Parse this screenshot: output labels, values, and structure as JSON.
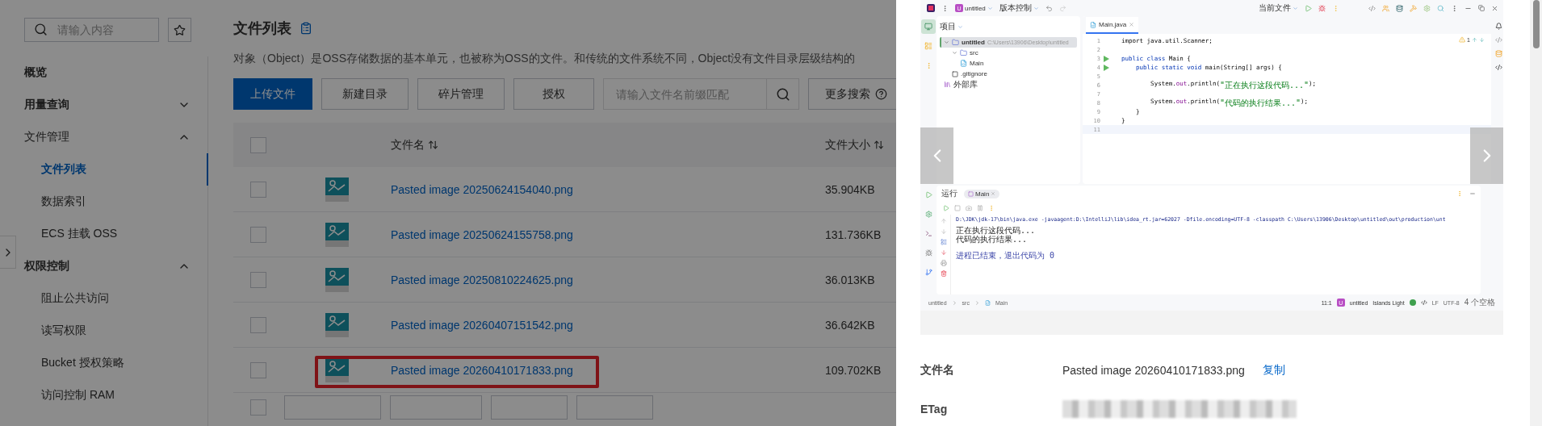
{
  "sidebar": {
    "search": {
      "placeholder": "请输入内容"
    },
    "items": [
      {
        "kind": "link",
        "label": "概览"
      },
      {
        "kind": "group",
        "label": "用量查询",
        "expanded": false
      },
      {
        "kind": "group",
        "label": "文件管理",
        "expanded": true,
        "children": [
          {
            "label": "文件列表",
            "selected": true
          },
          {
            "label": "数据索引",
            "selected": false
          },
          {
            "label": "ECS 挂载 OSS",
            "selected": false
          }
        ]
      },
      {
        "kind": "group",
        "label": "权限控制",
        "expanded": true,
        "children": [
          {
            "label": "阻止公共访问",
            "selected": false
          },
          {
            "label": "读写权限",
            "selected": false
          },
          {
            "label": "Bucket 授权策略",
            "selected": false
          },
          {
            "label": "访问控制 RAM",
            "selected": false
          }
        ]
      }
    ]
  },
  "main": {
    "title": "文件列表",
    "description": "对象（Object）是OSS存储数据的基本单元，也被称为OSS的文件。和传统的文件系统不同，Object没有文件目录层级结构的",
    "toolbar": [
      {
        "label": "上传文件",
        "kind": "primary"
      },
      {
        "label": "新建目录",
        "kind": "default"
      },
      {
        "label": "碎片管理",
        "kind": "default"
      },
      {
        "label": "授权",
        "kind": "default"
      }
    ],
    "search": {
      "placeholder": "请输入文件名前缀匹配"
    },
    "more_search": "更多搜索",
    "table": {
      "all_checked": false,
      "partial_row": {
        "checked": false
      },
      "columns": [
        "文件名",
        "文件大小"
      ],
      "rows": [
        {
          "name": "Pasted image 20250624154040.png",
          "size": "35.904KB",
          "checked": false,
          "highlighted": false
        },
        {
          "name": "Pasted image 20250624155758.png",
          "size": "131.736KB",
          "checked": false,
          "highlighted": false
        },
        {
          "name": "Pasted image 20250810224625.png",
          "size": "36.013KB",
          "checked": false,
          "highlighted": false
        },
        {
          "name": "Pasted image 20260407151542.png",
          "size": "36.642KB",
          "checked": false,
          "highlighted": false
        },
        {
          "name": "Pasted image 20260410171833.png",
          "size": "109.702KB",
          "checked": false,
          "highlighted": true
        }
      ]
    }
  },
  "preview": {
    "ide": {
      "project_initial": "U",
      "project": "untitled",
      "vcs": "版本控制",
      "run_config": "当前文件",
      "tree_title": "项目",
      "tree": [
        {
          "label": "untitled",
          "path": "C:\\Users\\13906\\Desktop\\untitled",
          "kind": "folder",
          "selected": true,
          "children": [
            {
              "label": "src",
              "kind": "folder",
              "selected": false,
              "children": [
                {
                  "label": "Main",
                  "kind": "class",
                  "selected": false
                }
              ]
            },
            {
              "label": ".gitignore",
              "kind": "file",
              "selected": false
            }
          ]
        },
        {
          "label": "外部库",
          "kind": "library",
          "selected": false
        }
      ],
      "tab": "Main.java",
      "warnings": "1",
      "code": [
        {
          "number": "1",
          "runnable": false,
          "current": false,
          "tokens": [
            {
              "kind": "plain",
              "text": "import java.util.Scanner;"
            }
          ]
        },
        {
          "number": "2",
          "runnable": false,
          "current": false
        },
        {
          "number": "3",
          "runnable": true,
          "current": false,
          "tokens": [
            {
              "kind": "keyword",
              "text": "public class "
            },
            {
              "kind": "plain",
              "text": "Main {"
            }
          ]
        },
        {
          "number": "4",
          "runnable": true,
          "current": false,
          "tokens": [
            {
              "kind": "keyword",
              "text": "    public static void "
            },
            {
              "kind": "plain",
              "text": "main(String[] args) {"
            }
          ]
        },
        {
          "number": "5",
          "runnable": false,
          "current": false
        },
        {
          "number": "6",
          "runnable": false,
          "current": false,
          "tokens": [
            {
              "kind": "plain",
              "text": "        System."
            },
            {
              "kind": "field",
              "text": "out"
            },
            {
              "kind": "plain",
              "text": ".println("
            },
            {
              "kind": "string",
              "text": "\"正在执行这段代码...\""
            },
            {
              "kind": "plain",
              "text": ");"
            }
          ]
        },
        {
          "number": "7",
          "runnable": false,
          "current": false
        },
        {
          "number": "8",
          "runnable": false,
          "current": false,
          "tokens": [
            {
              "kind": "plain",
              "text": "        System."
            },
            {
              "kind": "field",
              "text": "out"
            },
            {
              "kind": "plain",
              "text": ".println("
            },
            {
              "kind": "string",
              "text": "\"代码的执行结果...\""
            },
            {
              "kind": "plain",
              "text": ");"
            }
          ]
        },
        {
          "number": "9",
          "runnable": false,
          "current": false,
          "tokens": [
            {
              "kind": "plain",
              "text": "    }"
            }
          ]
        },
        {
          "number": "10",
          "runnable": false,
          "current": false,
          "tokens": [
            {
              "kind": "plain",
              "text": "}"
            }
          ]
        },
        {
          "number": "11",
          "runnable": false,
          "current": true
        }
      ],
      "run_title": "运行",
      "run_tab": "Main",
      "console": [
        {
          "kind": "command",
          "text": "D:\\JDK\\jdk-17\\bin\\java.exe -javaagent:D:\\IntelliJ\\lib\\idea_rt.jar=62027 -Dfile.encoding=UTF-8 -classpath C:\\Users\\13906\\Desktop\\untitled\\out\\production\\unt"
        },
        {
          "kind": "output",
          "text": "正在执行这段代码..."
        },
        {
          "kind": "output",
          "text": "代码的执行结果..."
        },
        {
          "kind": "blank"
        },
        {
          "kind": "exit",
          "text": "进程已结束，退出代码为 0"
        }
      ],
      "breadcrumb": [
        "untitled",
        "src",
        "Main"
      ],
      "status": {
        "position": "11:1",
        "project_initial": "U",
        "project": "untitled",
        "theme": "Islands Light",
        "line_sep": "LF",
        "encoding": "UTF-8",
        "indent": "4 个空格"
      }
    },
    "details": [
      {
        "kind": "text",
        "label": "文件名",
        "value": "Pasted image 20260410171833.png",
        "action": "复制"
      },
      {
        "kind": "redacted",
        "label": "ETag"
      }
    ]
  }
}
